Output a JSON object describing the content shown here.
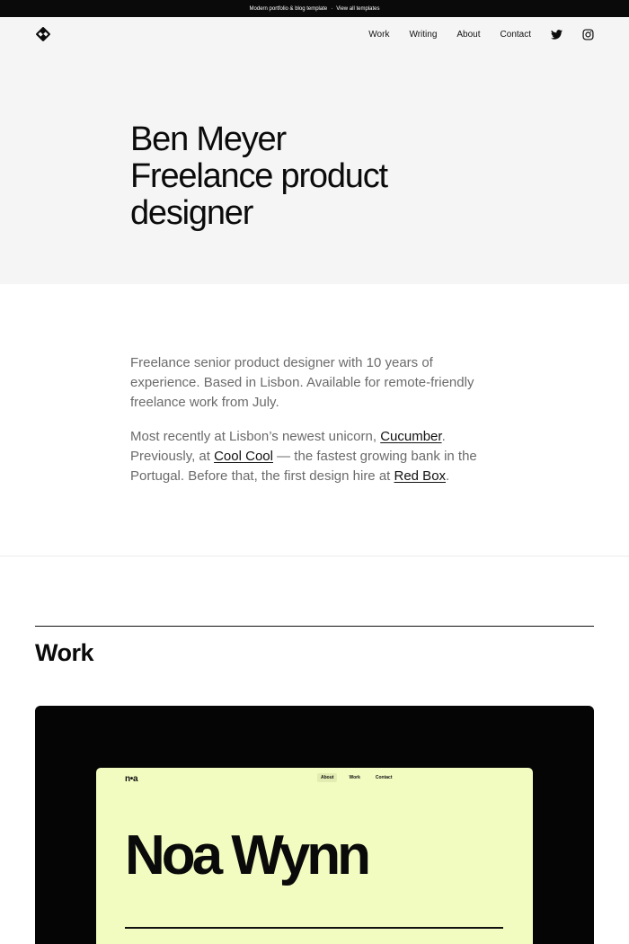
{
  "announcement": {
    "text": "Modern portfolio & blog template",
    "separator": "·",
    "link": "View all templates"
  },
  "nav": {
    "logo_icon": "diamond-logo-icon",
    "items": [
      {
        "label": "Work"
      },
      {
        "label": "Writing"
      },
      {
        "label": "About"
      },
      {
        "label": "Contact"
      }
    ],
    "social": [
      "twitter-icon",
      "instagram-icon"
    ]
  },
  "hero": {
    "line1": "Ben Meyer",
    "line2": "Freelance product",
    "line3": "designer"
  },
  "bio": {
    "p1": "Freelance senior product designer with 10 years of experience. Based in Lisbon. Available for remote-friendly freelance work from July.",
    "p2_a": "Most recently at Lisbon’s newest unicorn, ",
    "p2_link1": "Cucumber",
    "p2_b": ". Previously, at ",
    "p2_link2": "Cool Cool",
    "p2_c": " — the fastest growing bank in the Portugal. Before that, the first design hire at ",
    "p2_link3": "Red Box",
    "p2_d": "."
  },
  "work": {
    "title": "Work",
    "card": {
      "background": "#050505",
      "preview_background": "#f2fbc0",
      "preview_logo": "n•a",
      "preview_links": [
        "About",
        "Work",
        "Contact"
      ],
      "preview_title": "Noa Wynn"
    }
  }
}
